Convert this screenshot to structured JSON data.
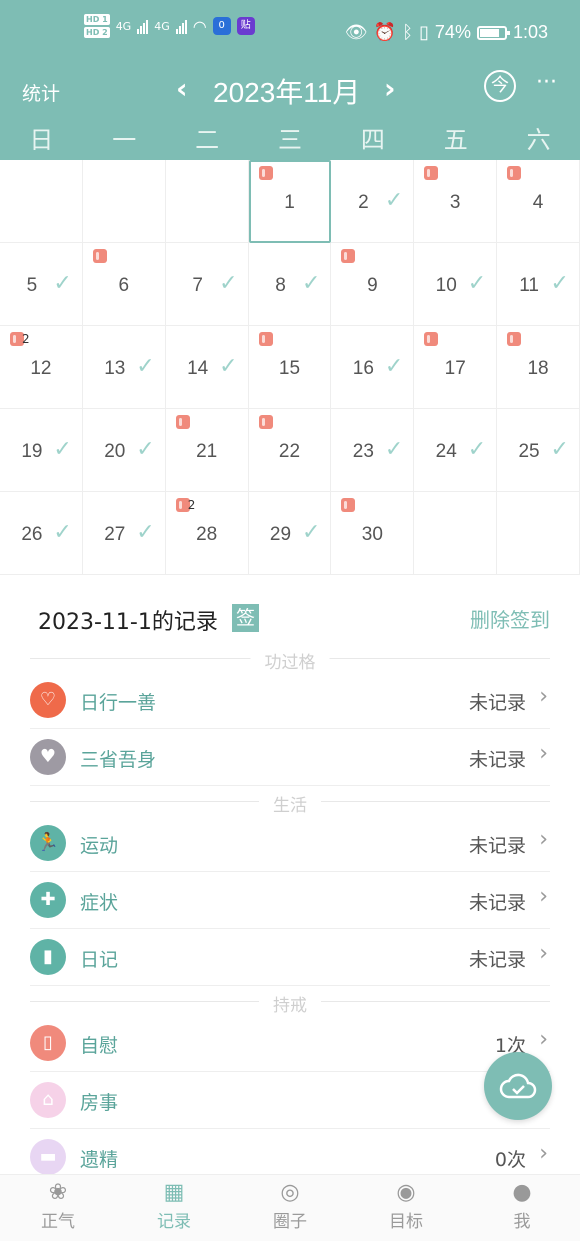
{
  "status_bar": {
    "network_left": "4G",
    "network_right": "4G",
    "battery": "74%",
    "time": "1:03",
    "app1": "0",
    "app2": "贴"
  },
  "header": {
    "stats_label": "统计",
    "prev": "‹",
    "title": "2023年11月",
    "next": "›",
    "today": "今",
    "more": "···"
  },
  "weekdays": [
    "日",
    "一",
    "二",
    "三",
    "四",
    "五",
    "六"
  ],
  "calendar": {
    "selected_day": "1",
    "days": [
      {
        "day": "",
        "check": false,
        "roll": false,
        "roll_count": ""
      },
      {
        "day": "",
        "check": false,
        "roll": false,
        "roll_count": ""
      },
      {
        "day": "",
        "check": false,
        "roll": false,
        "roll_count": ""
      },
      {
        "day": "1",
        "check": false,
        "roll": true,
        "roll_count": ""
      },
      {
        "day": "2",
        "check": true,
        "roll": false,
        "roll_count": ""
      },
      {
        "day": "3",
        "check": false,
        "roll": true,
        "roll_count": ""
      },
      {
        "day": "4",
        "check": false,
        "roll": true,
        "roll_count": ""
      },
      {
        "day": "5",
        "check": true,
        "roll": false,
        "roll_count": ""
      },
      {
        "day": "6",
        "check": false,
        "roll": true,
        "roll_count": ""
      },
      {
        "day": "7",
        "check": true,
        "roll": false,
        "roll_count": ""
      },
      {
        "day": "8",
        "check": true,
        "roll": false,
        "roll_count": ""
      },
      {
        "day": "9",
        "check": false,
        "roll": true,
        "roll_count": ""
      },
      {
        "day": "10",
        "check": true,
        "roll": false,
        "roll_count": ""
      },
      {
        "day": "11",
        "check": true,
        "roll": false,
        "roll_count": ""
      },
      {
        "day": "12",
        "check": false,
        "roll": true,
        "roll_count": "2"
      },
      {
        "day": "13",
        "check": true,
        "roll": false,
        "roll_count": ""
      },
      {
        "day": "14",
        "check": true,
        "roll": false,
        "roll_count": ""
      },
      {
        "day": "15",
        "check": false,
        "roll": true,
        "roll_count": ""
      },
      {
        "day": "16",
        "check": true,
        "roll": false,
        "roll_count": ""
      },
      {
        "day": "17",
        "check": false,
        "roll": true,
        "roll_count": ""
      },
      {
        "day": "18",
        "check": false,
        "roll": true,
        "roll_count": ""
      },
      {
        "day": "19",
        "check": true,
        "roll": false,
        "roll_count": ""
      },
      {
        "day": "20",
        "check": true,
        "roll": false,
        "roll_count": ""
      },
      {
        "day": "21",
        "check": false,
        "roll": true,
        "roll_count": ""
      },
      {
        "day": "22",
        "check": false,
        "roll": true,
        "roll_count": ""
      },
      {
        "day": "23",
        "check": true,
        "roll": false,
        "roll_count": ""
      },
      {
        "day": "24",
        "check": true,
        "roll": false,
        "roll_count": ""
      },
      {
        "day": "25",
        "check": true,
        "roll": false,
        "roll_count": ""
      },
      {
        "day": "26",
        "check": true,
        "roll": false,
        "roll_count": ""
      },
      {
        "day": "27",
        "check": true,
        "roll": false,
        "roll_count": ""
      },
      {
        "day": "28",
        "check": false,
        "roll": true,
        "roll_count": "2"
      },
      {
        "day": "29",
        "check": true,
        "roll": false,
        "roll_count": ""
      },
      {
        "day": "30",
        "check": false,
        "roll": true,
        "roll_count": ""
      },
      {
        "day": "",
        "check": false,
        "roll": false,
        "roll_count": ""
      },
      {
        "day": "",
        "check": false,
        "roll": false,
        "roll_count": ""
      }
    ]
  },
  "record": {
    "title": "2023-11-1的记录",
    "sign_badge": "签",
    "delete_label": "删除签到"
  },
  "sections": {
    "merit": "功过格",
    "life": "生活",
    "precepts": "持戒"
  },
  "items": {
    "good_deed": {
      "label": "日行一善",
      "value": "未记录",
      "icon": "heart-icon",
      "color": "#ef6a4a"
    },
    "reflect": {
      "label": "三省吾身",
      "value": "未记录",
      "icon": "broken-heart-icon",
      "color": "#9e9aa3"
    },
    "exercise": {
      "label": "运动",
      "value": "未记录",
      "icon": "running-icon",
      "color": "#5fb3a6"
    },
    "symptom": {
      "label": "症状",
      "value": "未记录",
      "icon": "medkit-icon",
      "color": "#5fb3a6"
    },
    "diary": {
      "label": "日记",
      "value": "未记录",
      "icon": "book-icon",
      "color": "#5fb3a6"
    },
    "masturbation": {
      "label": "自慰",
      "value": "1次",
      "icon": "tissue-roll-icon",
      "color": "#f08a7c"
    },
    "sex": {
      "label": "房事",
      "value": "",
      "icon": "house-icon",
      "color": "#f6d2e8"
    },
    "emission": {
      "label": "遗精",
      "value": "0次",
      "icon": "bed-icon",
      "color": "#e8d6f3"
    }
  },
  "fab": {
    "icon": "cloud-sync-icon"
  },
  "bottom_nav": [
    {
      "label": "正气",
      "icon": "lotus-icon",
      "active": false
    },
    {
      "label": "记录",
      "icon": "calendar-icon",
      "active": true
    },
    {
      "label": "圈子",
      "icon": "circle-c-icon",
      "active": false
    },
    {
      "label": "目标",
      "icon": "target-icon",
      "active": false
    },
    {
      "label": "我",
      "icon": "user-icon",
      "active": false
    }
  ]
}
